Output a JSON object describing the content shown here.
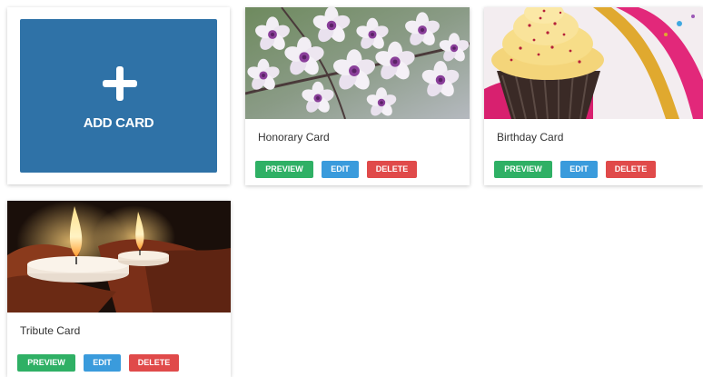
{
  "add_card": {
    "label": "ADD CARD",
    "icon": "plus-icon"
  },
  "cards": [
    {
      "title": "Honorary Card",
      "image": "cherry-blossom-photo",
      "preview_label": "PREVIEW",
      "edit_label": "EDIT",
      "delete_label": "DELETE"
    },
    {
      "title": "Birthday Card",
      "image": "cupcake-photo",
      "preview_label": "PREVIEW",
      "edit_label": "EDIT",
      "delete_label": "DELETE"
    },
    {
      "title": "Tribute Card",
      "image": "candles-photo",
      "preview_label": "PREVIEW",
      "edit_label": "EDIT",
      "delete_label": "DELETE"
    }
  ],
  "colors": {
    "add_card_bg": "#2f72a7",
    "preview": "#2fb065",
    "edit": "#3a9bdc",
    "delete": "#e04a4a"
  }
}
